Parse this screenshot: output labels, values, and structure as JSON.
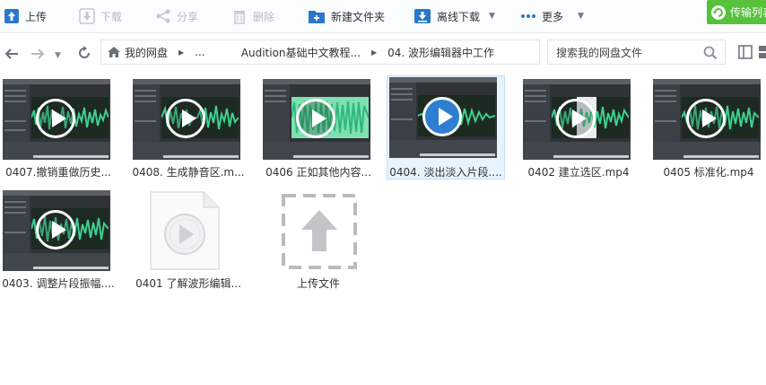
{
  "toolbar": {
    "upload": "上传",
    "download": "下载",
    "share": "分享",
    "delete": "删除",
    "new_folder": "新建文件夹",
    "offline_download": "离线下载",
    "more": "更多",
    "transfer_list": "传输列表"
  },
  "breadcrumb": {
    "root": "我的网盘",
    "ellipsis": "...",
    "level1": "Audition基础中文教程...",
    "level2": "04. 波形编辑器中工作"
  },
  "search": {
    "placeholder": "搜索我的网盘文件"
  },
  "files": [
    {
      "name": "0407.撤销重做历史...",
      "type": "video",
      "selected": false
    },
    {
      "name": "0408. 生成静音区.m...",
      "type": "video",
      "selected": false
    },
    {
      "name": "0406  正如其他内容...",
      "type": "video",
      "selected": false
    },
    {
      "name": "0404. 淡出淡入片段....",
      "type": "video",
      "selected": true
    },
    {
      "name": "0402  建立选区.mp4",
      "type": "video",
      "selected": false
    },
    {
      "name": "0405  标准化.mp4",
      "type": "video",
      "selected": false
    },
    {
      "name": "0403. 调整片段振幅....",
      "type": "video",
      "selected": false
    },
    {
      "name": "0401  了解波形编辑...",
      "type": "document",
      "selected": false
    },
    {
      "name": "上传文件",
      "type": "upload",
      "selected": false
    }
  ],
  "colors": {
    "accent": "#2e7fd1",
    "transfer_green": "#56c13a",
    "waveform": "#3ecf8e"
  }
}
